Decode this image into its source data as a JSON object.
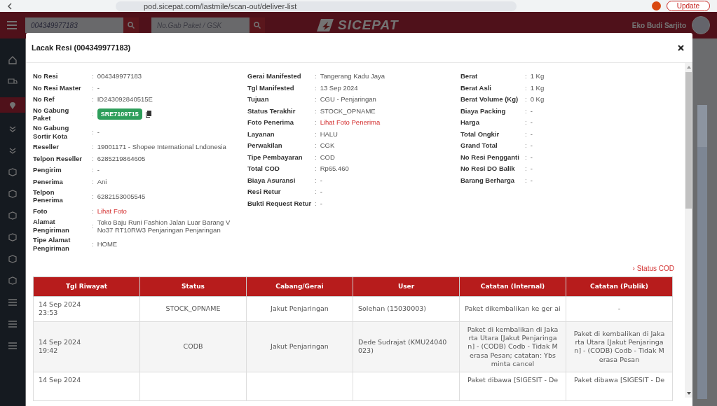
{
  "browser": {
    "url": "pod.sicepat.com/lastmile/scan-out/deliver-list",
    "update_button": "Update"
  },
  "header": {
    "search_value": "004349977183",
    "search2_placeholder": "No.Gab Paket / GSK",
    "logo": "SICEPAT",
    "user_name": "Eko Budi Sarjito"
  },
  "modal": {
    "title": "Lacak Resi (004349977183)"
  },
  "info_columns": [
    [
      {
        "label": "No Resi",
        "value": "004349977183",
        "kind": "text"
      },
      {
        "label": "No Resi Master",
        "value": "-",
        "kind": "text"
      },
      {
        "label": "No Ref",
        "value": "ID243092840515E",
        "kind": "text"
      },
      {
        "label": "No Gabung\nPaket",
        "value": "SRE7109T15",
        "kind": "badge"
      },
      {
        "label": "No Gabung\nSortir Kota",
        "value": "-",
        "kind": "text"
      },
      {
        "label": "Reseller",
        "value": "19001171 - Shopee International Lndonesia",
        "kind": "text"
      },
      {
        "label": "Telpon Reseller",
        "value": "6285219864605",
        "kind": "text"
      },
      {
        "label": "Pengirim",
        "value": "-",
        "kind": "text"
      },
      {
        "label": "Penerima",
        "value": "Ani",
        "kind": "text"
      },
      {
        "label": "Telpon\nPenerima",
        "value": "6282153005545",
        "kind": "text"
      },
      {
        "label": "Foto",
        "value": "Lihat Foto",
        "kind": "link"
      },
      {
        "label": "Alamat\nPengiriman",
        "value": "Toko Baju Runi Fashion Jalan Luar Barang V No37 RT10RW3 Penjaringan Penjaringan",
        "kind": "text"
      },
      {
        "label": "Tipe Alamat\nPengiriman",
        "value": "HOME",
        "kind": "text"
      }
    ],
    [
      {
        "label": "Gerai Manifested",
        "value": "Tangerang Kadu Jaya",
        "kind": "text"
      },
      {
        "label": "Tgl Manifested",
        "value": "13 Sep 2024",
        "kind": "text"
      },
      {
        "label": "Tujuan",
        "value": "CGU - Penjaringan",
        "kind": "text"
      },
      {
        "label": "Status Terakhir",
        "value": "STOCK_OPNAME",
        "kind": "text"
      },
      {
        "label": "Foto Penerima",
        "value": "Lihat Foto Penerima",
        "kind": "link"
      },
      {
        "label": "Layanan",
        "value": "HALU",
        "kind": "text"
      },
      {
        "label": "Perwakilan",
        "value": "CGK",
        "kind": "text"
      },
      {
        "label": "Tipe Pembayaran",
        "value": "COD",
        "kind": "text"
      },
      {
        "label": "Total COD",
        "value": "Rp65.460",
        "kind": "text"
      },
      {
        "label": "Biaya Asuransi",
        "value": "-",
        "kind": "text"
      },
      {
        "label": "Resi Retur",
        "value": "-",
        "kind": "text"
      },
      {
        "label": "Bukti Request Retur",
        "value": "-",
        "kind": "text"
      }
    ],
    [
      {
        "label": "Berat",
        "value": "1 Kg",
        "kind": "text"
      },
      {
        "label": "Berat Asli",
        "value": "1 Kg",
        "kind": "text"
      },
      {
        "label": "Berat Volume (Kg)",
        "value": "0 Kg",
        "kind": "text"
      },
      {
        "label": "Biaya Packing",
        "value": "-",
        "kind": "text"
      },
      {
        "label": "Harga",
        "value": "-",
        "kind": "text"
      },
      {
        "label": "Total Ongkir",
        "value": "-",
        "kind": "text"
      },
      {
        "label": "Grand Total",
        "value": "-",
        "kind": "text"
      },
      {
        "label": "No Resi Pengganti",
        "value": "-",
        "kind": "text"
      },
      {
        "label": "No Resi DO Balik",
        "value": "-",
        "kind": "text"
      },
      {
        "label": "Barang Berharga",
        "value": "-",
        "kind": "text"
      }
    ]
  ],
  "separator": ":",
  "status_cod_link": "› Status COD",
  "table": {
    "columns": [
      "Tgl Riwayat",
      "Status",
      "Cabang/Gerai",
      "User",
      "Catatan (Internal)",
      "Catatan (Publik)"
    ],
    "rows": [
      [
        "14 Sep 2024\n23:53",
        "STOCK_OPNAME",
        "Jakut Penjaringan",
        "Solehan (15030003)",
        "Paket dikembalikan ke ger ai",
        "-"
      ],
      [
        "14 Sep 2024\n19:42",
        "CODB",
        "Jakut Penjaringan",
        "Dede Sudrajat (KMU24040 023)",
        "Paket di kembalikan di Jaka rta Utara [Jakut Penjaringa n] - (CODB) Codb - Tidak M erasa Pesan; catatan: Ybs minta cancel",
        "Paket di kembalikan di Jaka rta Utara [Jakut Penjaringa n] - (CODB) Codb - Tidak M erasa Pesan"
      ],
      [
        "14 Sep 2024",
        "",
        "",
        "",
        "Paket dibawa [SIGESIT - De",
        "Paket dibawa [SIGESIT - De"
      ]
    ]
  }
}
